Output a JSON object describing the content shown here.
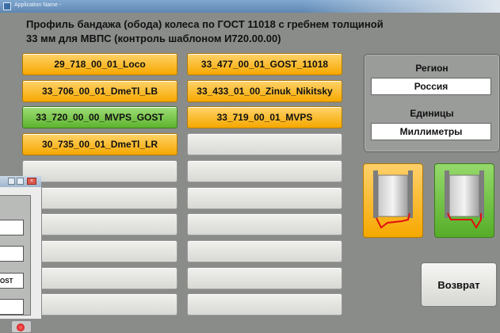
{
  "window": {
    "title": "Application Name -"
  },
  "header": {
    "line1": "Профиль бандажа (обода) колеса по ГОСТ 11018 с гребнем толщиной",
    "line2": "33 мм для МВПС (контроль  шаблоном И720.00.00)"
  },
  "profiles": {
    "left": [
      {
        "label": "29_718_00_01_Loco",
        "state": "orange"
      },
      {
        "label": "33_706_00_01_DmeTl_LB",
        "state": "orange"
      },
      {
        "label": "33_720_00_00_MVPS_GOST",
        "state": "green"
      },
      {
        "label": "30_735_00_01_DmeTl_LR",
        "state": "orange"
      },
      {
        "label": "",
        "state": "empty"
      },
      {
        "label": "",
        "state": "empty"
      },
      {
        "label": "",
        "state": "empty"
      },
      {
        "label": "",
        "state": "empty"
      },
      {
        "label": "",
        "state": "empty"
      },
      {
        "label": "",
        "state": "empty"
      }
    ],
    "right": [
      {
        "label": "33_477_00_01_GOST_11018",
        "state": "orange"
      },
      {
        "label": "33_433_01_00_Zinuk_Nikitsky",
        "state": "orange"
      },
      {
        "label": "33_719_00_01_MVPS",
        "state": "orange"
      },
      {
        "label": "",
        "state": "empty"
      },
      {
        "label": "",
        "state": "empty"
      },
      {
        "label": "",
        "state": "empty"
      },
      {
        "label": "",
        "state": "empty"
      },
      {
        "label": "",
        "state": "empty"
      },
      {
        "label": "",
        "state": "empty"
      },
      {
        "label": "",
        "state": "empty"
      }
    ]
  },
  "settings": {
    "region_label": "Регион",
    "region_value": "Россия",
    "units_label": "Единицы",
    "units_value": "Миллиметры"
  },
  "buttons": {
    "return_label": "Возврат"
  },
  "secondary_window": {
    "field3_text": "OST"
  },
  "colors": {
    "orange": "#f6a800",
    "green": "#5db42e",
    "background": "#8a8c8a"
  }
}
